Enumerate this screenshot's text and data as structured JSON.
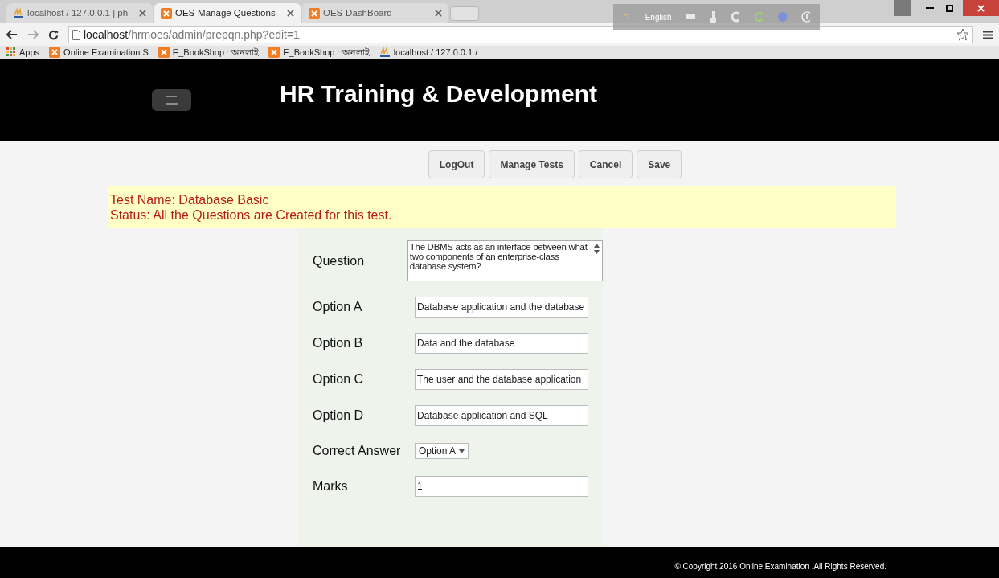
{
  "browser": {
    "tabs": [
      {
        "title": "localhost / 127.0.0.1 | ph",
        "kind": "pma",
        "selected": false
      },
      {
        "title": "OES-Manage Questions",
        "kind": "xampp",
        "selected": true
      },
      {
        "title": "OES-DashBoard",
        "kind": "xampp",
        "selected": false
      }
    ],
    "language_bar": {
      "language": "English"
    },
    "url": {
      "host": "localhost",
      "path": "/hrmoes/admin/prepqn.php?edit=1"
    },
    "bookmarks": [
      {
        "label": "Apps",
        "kind": "apps"
      },
      {
        "label": "Online Examination S",
        "kind": "xampp"
      },
      {
        "label": "E_BookShop ::অনলাই",
        "kind": "xampp"
      },
      {
        "label": "E_BookShop ::অনলাই",
        "kind": "xampp"
      },
      {
        "label": "localhost / 127.0.0.1 /",
        "kind": "pma"
      }
    ]
  },
  "header": {
    "title": "HR Training & Development"
  },
  "buttons": [
    "LogOut",
    "Manage Tests",
    "Cancel",
    "Save"
  ],
  "notice": [
    "Test Name: Database Basic",
    "Status: All the Questions are Created for this test."
  ],
  "form": [
    {
      "label": "Question",
      "kind": "textarea",
      "value": "The DBMS acts as an interface between what two components of an enterprise-class database system?"
    },
    {
      "label": "Option A",
      "kind": "text",
      "value": "Database application and the database"
    },
    {
      "label": "Option B",
      "kind": "text",
      "value": "Data and the database"
    },
    {
      "label": "Option C",
      "kind": "text",
      "value": "The user and the database application"
    },
    {
      "label": "Option D",
      "kind": "text",
      "value": "Database application and SQL"
    },
    {
      "label": "Correct Answer",
      "kind": "select",
      "value": "Option A"
    },
    {
      "label": "Marks",
      "kind": "text",
      "value": "1"
    }
  ],
  "footer": "© Copyright 2016 Online Examination .All Rights Reserved."
}
